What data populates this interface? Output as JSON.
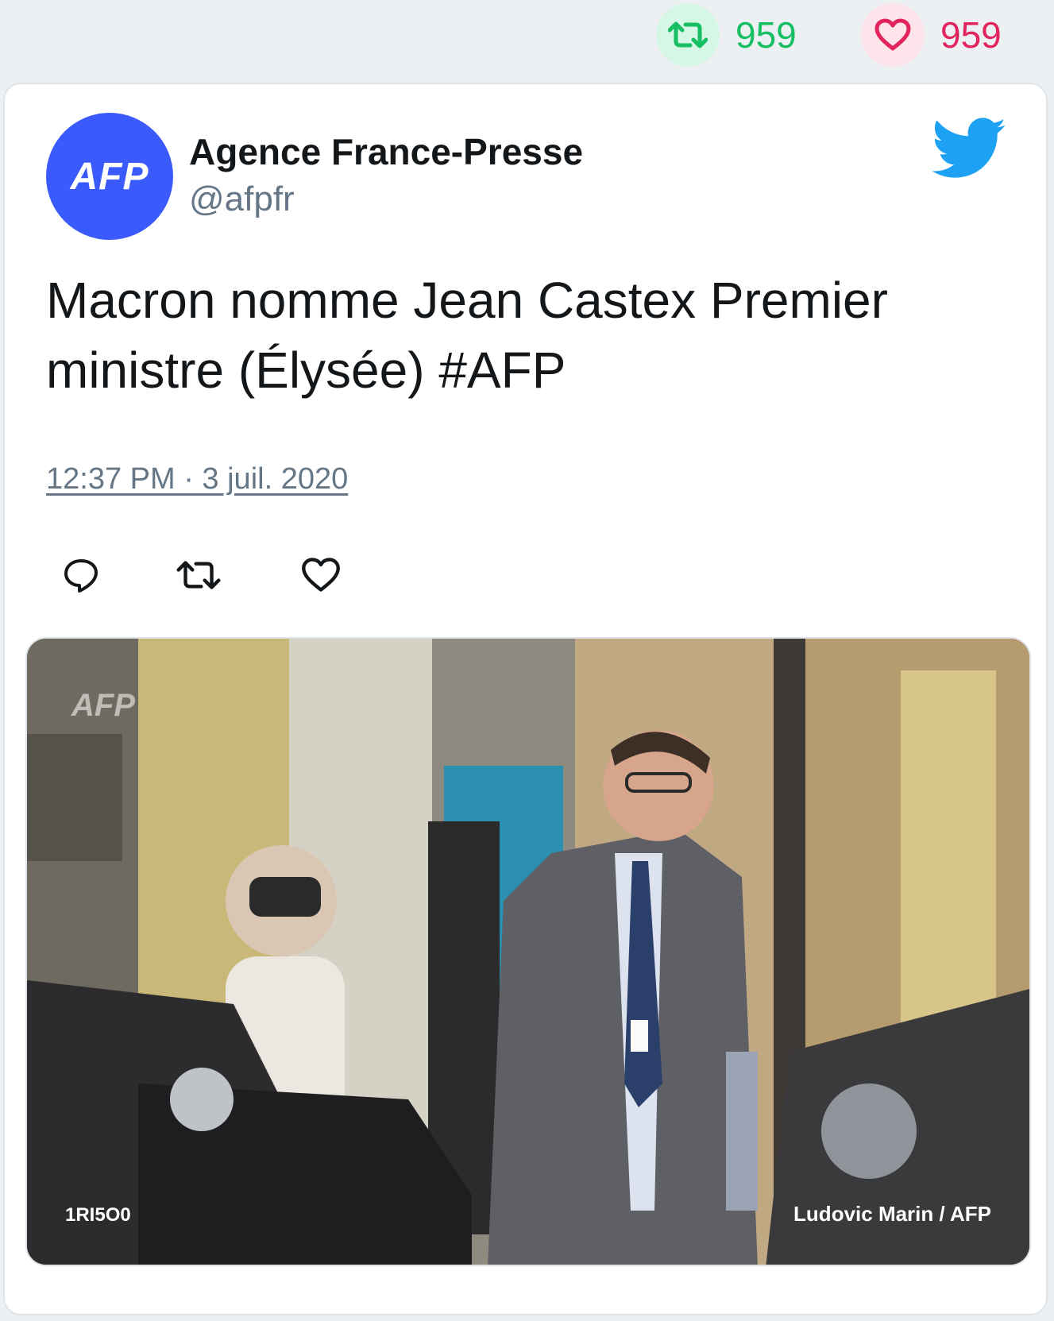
{
  "stats": {
    "retweets": "959",
    "likes": "959",
    "retweet_icon": "retweet-icon",
    "like_icon": "heart-icon",
    "retweet_color": "#17bf63",
    "like_color": "#e0245e"
  },
  "tweet": {
    "avatar_text": "AFP",
    "avatar_color": "#3a5afc",
    "author_name": "Agence France-Presse",
    "handle": "@afpfr",
    "platform_icon": "twitter-bird-icon",
    "text": "Macron nomme Jean Castex Premier ministre (Élysée) #AFP",
    "timestamp": "12:37 PM · 3 juil. 2020",
    "actions": [
      "reply-icon",
      "retweet-icon",
      "like-icon"
    ]
  },
  "media": {
    "watermark": "AFP",
    "photo_code": "1RI5O0",
    "credit": "Ludovic Marin / AFP"
  }
}
